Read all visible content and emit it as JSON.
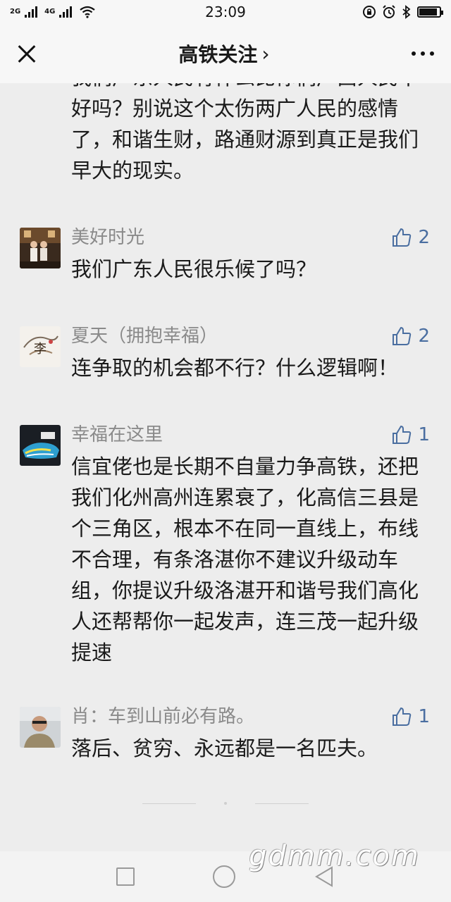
{
  "status_bar": {
    "network_left": "2G",
    "network_right": "4G",
    "time": "23:09"
  },
  "nav": {
    "title": "高铁关注",
    "title_chevron": "›"
  },
  "previous_comment_tail": "我们广东人民有什么比你们广西人民不好吗？别说这个太伤两广人民的感情了，和谐生财，路通财源到真正是我们早大的现实。",
  "comments": [
    {
      "name": "美好时光",
      "likes": "2",
      "text": "我们广东人民很乐候了吗？",
      "avatar": "photo-of-two-people"
    },
    {
      "name": "夏天（拥抱幸福）",
      "likes": "2",
      "text": "连争取的机会都不行？什么逻辑啊！",
      "avatar": "calligraphy-art"
    },
    {
      "name": "幸福在这里",
      "likes": "1",
      "text": "信宜佬也是长期不自量力争高铁，还把我们化州高州连累衰了，化高信三县是个三角区，根本不在同一直线上，布线不合理，有条洛湛你不建议升级动车组，你提议升级洛湛开和谐号我们高化人还帮帮你一起发声，连三茂一起升级提速",
      "avatar": "colorful-shoes"
    },
    {
      "name": "肖：车到山前必有路。",
      "likes": "1",
      "text": "落后、贫穷、永远都是一名匹夫。",
      "avatar": "man-portrait"
    }
  ],
  "watermark": "gdmm.com",
  "colors": {
    "background": "#ededed",
    "name_gray": "#8a8a8a",
    "like_blue": "#4a6ea0"
  },
  "icons": {
    "like": "thumbs-up-icon",
    "close": "close-icon",
    "more": "more-dots-icon"
  }
}
